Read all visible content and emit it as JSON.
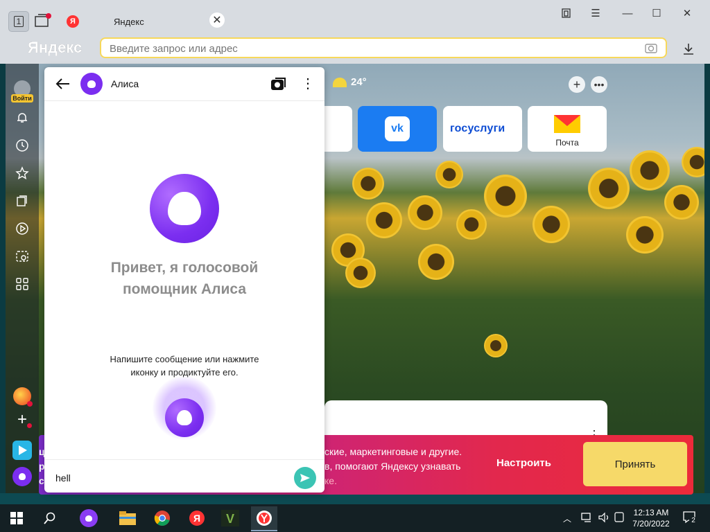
{
  "browser": {
    "tab_home_number": "1",
    "tab_title": "Яндекс",
    "tab_favicon_letter": "Я",
    "logo": "Яндекс",
    "address_placeholder": "Введите запрос или адрес"
  },
  "sidebar": {
    "login_label": "Войти",
    "icons": [
      "user-avatar-icon",
      "bell-icon",
      "history-icon",
      "bookmarks-star-icon",
      "collections-icon",
      "play-icon",
      "screenshot-icon",
      "apps-grid-icon"
    ],
    "bottom_icons": [
      "yandex-services-icon",
      "add-icon",
      "yandex-play-icon",
      "alice-icon"
    ]
  },
  "alice": {
    "title": "Алиса",
    "greeting_line1": "Привет, я голосовой",
    "greeting_line2": "помощник Алиса",
    "hint_line1": "Напишите сообщение или нажмите",
    "hint_line2": "иконку и продиктуйте его.",
    "input_value": "hell"
  },
  "newtab": {
    "weather_temp": "24°",
    "tiles": [
      {
        "label": "vk"
      },
      {
        "label": "госуслуги"
      },
      {
        "label": "Почта"
      }
    ]
  },
  "cookie": {
    "line1": "ские, маркетинговые и другие.",
    "line2": "в, помогают Яндексу узнавать",
    "line3": "ке.",
    "configure_label": "Настроить",
    "accept_label": "Принять",
    "left_letters": [
      "ц",
      "р",
      "с"
    ]
  },
  "taskbar": {
    "time": "12:13 AM",
    "date": "7/20/2022",
    "notification_count": "2"
  },
  "colors": {
    "accent_yellow": "#f7d85a",
    "alice_purple": "#7b2ef0",
    "send_teal": "#3bc4b4",
    "vk_blue": "#1b7cf2"
  }
}
